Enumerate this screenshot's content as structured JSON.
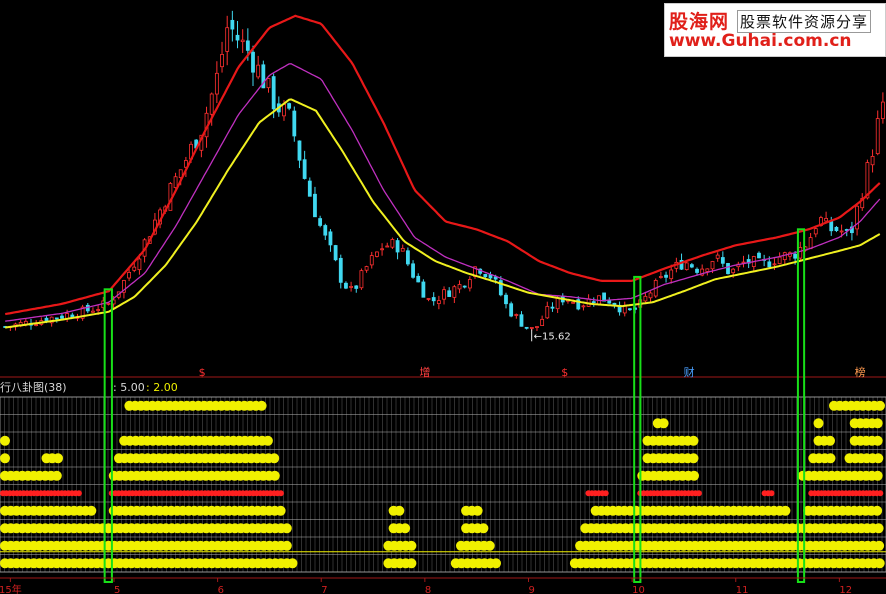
{
  "logo": {
    "brand": "股海网",
    "tagline": "股票软件资源分享",
    "url": "www.Guhai.com.cn"
  },
  "indicator": {
    "name": "行八卦图(38)",
    "param1": ": 5.00",
    "param2": ": 2.00"
  },
  "price_marker": "←15.62",
  "signal_labels": [
    {
      "text": "$",
      "month": 5.85,
      "color": "#ff3030"
    },
    {
      "text": "增",
      "month": 8.0,
      "color": "#ff4040"
    },
    {
      "text": "$",
      "month": 9.35,
      "color": "#ff3030"
    },
    {
      "text": "财",
      "month": 10.55,
      "color": "#4aa0ff"
    },
    {
      "text": "榜",
      "month": 12.2,
      "color": "#ff9a50"
    }
  ],
  "colors": {
    "background": "#000000",
    "up_candle": "#ff3030",
    "down_candle": "#40d8f0",
    "ma_red": "#e81818",
    "ma_magenta": "#c030c0",
    "ma_yellow": "#f0f020",
    "dot_yellow": "#f0f000",
    "dot_red": "#ff2020",
    "signal_box": "#18e018",
    "grid": "#b8b8b8"
  },
  "chart_data": {
    "type": "candlestick",
    "x_ticks": [
      "15年",
      "5",
      "6",
      "7",
      "8",
      "9",
      "10",
      "11",
      "12"
    ],
    "x_tick_months": [
      4.0,
      5.0,
      6.0,
      7.0,
      8.0,
      9.0,
      10.0,
      11.0,
      12.0
    ],
    "x_range": [
      3.9,
      12.45
    ],
    "y_range": [
      12.5,
      58.0
    ],
    "price_marker_value": 15.62,
    "price_marker_month": 9.05,
    "close_path": [
      [
        3.95,
        16.7
      ],
      [
        4.2,
        17.3
      ],
      [
        4.45,
        18.0
      ],
      [
        4.7,
        18.6
      ],
      [
        4.95,
        19.6
      ],
      [
        5.1,
        22.5
      ],
      [
        5.3,
        27.5
      ],
      [
        5.5,
        33.0
      ],
      [
        5.7,
        38.0
      ],
      [
        5.85,
        42.0
      ],
      [
        6.0,
        48.5
      ],
      [
        6.1,
        55.0
      ],
      [
        6.2,
        53.0
      ],
      [
        6.3,
        51.5
      ],
      [
        6.4,
        49.0
      ],
      [
        6.55,
        45.0
      ],
      [
        6.7,
        43.0
      ],
      [
        6.85,
        35.0
      ],
      [
        7.0,
        29.0
      ],
      [
        7.1,
        26.0
      ],
      [
        7.2,
        22.5
      ],
      [
        7.3,
        21.0
      ],
      [
        7.45,
        24.5
      ],
      [
        7.6,
        27.0
      ],
      [
        7.75,
        27.0
      ],
      [
        7.9,
        23.0
      ],
      [
        8.05,
        19.8
      ],
      [
        8.2,
        21.0
      ],
      [
        8.35,
        22.0
      ],
      [
        8.5,
        24.5
      ],
      [
        8.65,
        23.0
      ],
      [
        8.8,
        19.0
      ],
      [
        8.95,
        17.0
      ],
      [
        9.05,
        16.2
      ],
      [
        9.2,
        19.0
      ],
      [
        9.35,
        20.5
      ],
      [
        9.5,
        19.5
      ],
      [
        9.65,
        20.5
      ],
      [
        9.8,
        20.0
      ],
      [
        9.95,
        18.5
      ],
      [
        10.05,
        19.0
      ],
      [
        10.2,
        21.5
      ],
      [
        10.35,
        23.5
      ],
      [
        10.5,
        25.0
      ],
      [
        10.65,
        24.0
      ],
      [
        10.8,
        25.5
      ],
      [
        10.95,
        23.5
      ],
      [
        11.1,
        25.0
      ],
      [
        11.25,
        24.5
      ],
      [
        11.4,
        25.5
      ],
      [
        11.55,
        25.8
      ],
      [
        11.7,
        27.5
      ],
      [
        11.8,
        30.5
      ],
      [
        11.9,
        29.0
      ],
      [
        12.0,
        29.0
      ],
      [
        12.1,
        28.0
      ],
      [
        12.2,
        33.0
      ],
      [
        12.3,
        38.0
      ],
      [
        12.4,
        44.0
      ]
    ],
    "ma_red": [
      [
        3.95,
        18.3
      ],
      [
        4.5,
        19.6
      ],
      [
        4.95,
        21.2
      ],
      [
        5.3,
        26.5
      ],
      [
        5.6,
        34.0
      ],
      [
        5.9,
        42.0
      ],
      [
        6.2,
        49.5
      ],
      [
        6.5,
        54.5
      ],
      [
        6.75,
        56.0
      ],
      [
        7.0,
        55.0
      ],
      [
        7.3,
        50.0
      ],
      [
        7.6,
        42.5
      ],
      [
        7.9,
        34.0
      ],
      [
        8.2,
        30.0
      ],
      [
        8.5,
        29.0
      ],
      [
        8.8,
        27.5
      ],
      [
        9.1,
        25.0
      ],
      [
        9.4,
        23.5
      ],
      [
        9.7,
        22.5
      ],
      [
        10.0,
        22.5
      ],
      [
        10.3,
        24.0
      ],
      [
        10.7,
        25.8
      ],
      [
        11.0,
        27.0
      ],
      [
        11.4,
        28.0
      ],
      [
        11.7,
        29.0
      ],
      [
        12.0,
        30.5
      ],
      [
        12.2,
        32.5
      ],
      [
        12.4,
        35.0
      ]
    ],
    "ma_magenta": [
      [
        3.95,
        17.4
      ],
      [
        4.5,
        18.4
      ],
      [
        4.95,
        19.8
      ],
      [
        5.3,
        23.5
      ],
      [
        5.6,
        29.5
      ],
      [
        5.9,
        36.5
      ],
      [
        6.2,
        43.5
      ],
      [
        6.5,
        48.5
      ],
      [
        6.7,
        50.0
      ],
      [
        7.0,
        48.0
      ],
      [
        7.3,
        41.5
      ],
      [
        7.6,
        34.0
      ],
      [
        7.9,
        28.0
      ],
      [
        8.2,
        25.5
      ],
      [
        8.5,
        24.0
      ],
      [
        8.8,
        22.5
      ],
      [
        9.1,
        20.8
      ],
      [
        9.4,
        20.5
      ],
      [
        9.7,
        20.0
      ],
      [
        10.0,
        20.3
      ],
      [
        10.3,
        22.0
      ],
      [
        10.7,
        23.5
      ],
      [
        11.0,
        24.5
      ],
      [
        11.4,
        25.5
      ],
      [
        11.7,
        26.5
      ],
      [
        12.0,
        28.0
      ],
      [
        12.2,
        30.0
      ],
      [
        12.4,
        33.0
      ]
    ],
    "ma_yellow": [
      [
        3.95,
        16.6
      ],
      [
        4.5,
        17.6
      ],
      [
        4.95,
        18.6
      ],
      [
        5.2,
        20.5
      ],
      [
        5.5,
        24.5
      ],
      [
        5.8,
        30.0
      ],
      [
        6.1,
        36.5
      ],
      [
        6.4,
        42.5
      ],
      [
        6.7,
        45.5
      ],
      [
        6.95,
        44.0
      ],
      [
        7.2,
        39.0
      ],
      [
        7.5,
        32.5
      ],
      [
        7.8,
        27.5
      ],
      [
        8.1,
        25.0
      ],
      [
        8.4,
        23.5
      ],
      [
        8.7,
        22.3
      ],
      [
        9.0,
        21.0
      ],
      [
        9.3,
        20.3
      ],
      [
        9.6,
        19.6
      ],
      [
        9.9,
        19.3
      ],
      [
        10.2,
        19.8
      ],
      [
        10.5,
        21.2
      ],
      [
        10.8,
        22.7
      ],
      [
        11.1,
        23.5
      ],
      [
        11.4,
        24.3
      ],
      [
        11.7,
        25.3
      ],
      [
        12.0,
        26.3
      ],
      [
        12.2,
        27.0
      ],
      [
        12.4,
        28.5
      ]
    ],
    "signal_boxes": [
      {
        "start": 4.91,
        "end": 4.98
      },
      {
        "start": 10.02,
        "end": 10.08
      },
      {
        "start": 11.6,
        "end": 11.66
      }
    ],
    "dot_rows": [
      {
        "level": 1,
        "color": "yellow",
        "segments": [
          [
            3.9,
            3.95
          ],
          [
            5.1,
            6.5
          ],
          [
            11.9,
            12.45
          ]
        ]
      },
      {
        "level": 2,
        "color": "yellow",
        "segments": [
          [
            10.2,
            10.4
          ],
          [
            11.75,
            11.85
          ],
          [
            12.1,
            12.45
          ]
        ]
      },
      {
        "level": 3,
        "color": "yellow",
        "segments": [
          [
            3.9,
            4.0
          ],
          [
            5.05,
            6.55
          ],
          [
            10.1,
            10.65
          ],
          [
            11.75,
            12.0
          ],
          [
            12.1,
            12.45
          ]
        ]
      },
      {
        "level": 4,
        "color": "yellow",
        "segments": [
          [
            3.9,
            4.05
          ],
          [
            4.3,
            4.55
          ],
          [
            5.0,
            6.6
          ],
          [
            10.1,
            10.65
          ],
          [
            11.7,
            12.0
          ],
          [
            12.05,
            12.45
          ]
        ]
      },
      {
        "level": 5,
        "color": "yellow",
        "segments": [
          [
            3.9,
            4.55
          ],
          [
            4.95,
            6.65
          ],
          [
            10.05,
            10.7
          ],
          [
            11.6,
            12.45
          ]
        ]
      },
      {
        "level": 6,
        "color": "red",
        "segments": [
          [
            3.9,
            4.7
          ],
          [
            4.95,
            6.65
          ],
          [
            9.55,
            9.8
          ],
          [
            10.05,
            10.7
          ],
          [
            10.3,
            10.45
          ],
          [
            11.25,
            11.4
          ],
          [
            11.7,
            12.45
          ]
        ]
      },
      {
        "level": 7,
        "color": "yellow",
        "segments": [
          [
            3.9,
            4.85
          ],
          [
            4.95,
            6.7
          ],
          [
            7.65,
            7.85
          ],
          [
            8.35,
            8.6
          ],
          [
            9.6,
            11.55
          ],
          [
            11.65,
            12.45
          ]
        ]
      },
      {
        "level": 8,
        "color": "yellow",
        "segments": [
          [
            3.9,
            6.72
          ],
          [
            7.65,
            7.9
          ],
          [
            8.35,
            8.65
          ],
          [
            9.5,
            12.45
          ]
        ]
      },
      {
        "level": 9,
        "color": "yellow",
        "segments": [
          [
            3.9,
            6.75
          ],
          [
            7.6,
            7.95
          ],
          [
            8.3,
            8.7
          ],
          [
            9.45,
            12.45
          ]
        ]
      },
      {
        "level": 10,
        "color": "yellow",
        "segments": [
          [
            3.9,
            6.8
          ],
          [
            7.6,
            7.95
          ],
          [
            8.25,
            8.75
          ],
          [
            9.4,
            12.45
          ]
        ]
      }
    ]
  }
}
